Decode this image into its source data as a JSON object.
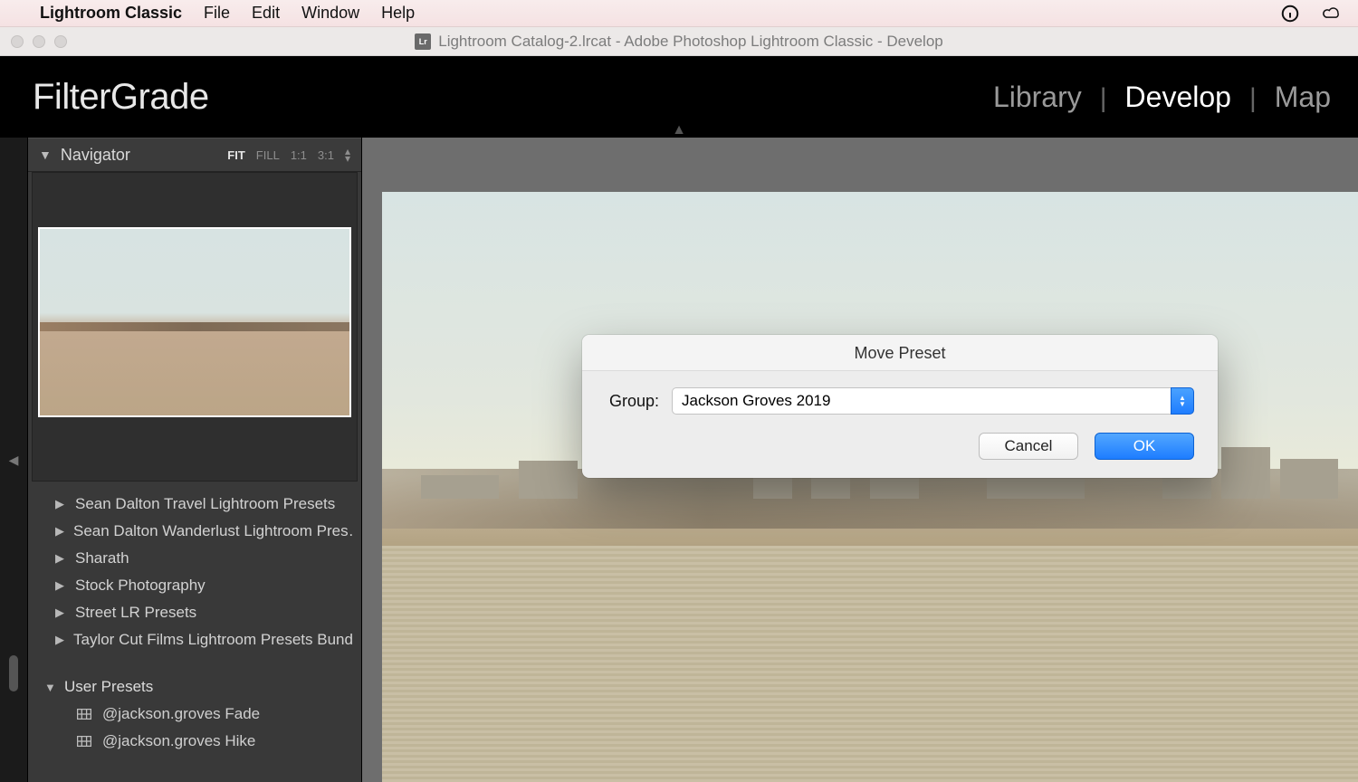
{
  "menubar": {
    "app_name": "Lightroom Classic",
    "items": [
      "File",
      "Edit",
      "Window",
      "Help"
    ]
  },
  "titlebar": {
    "doc_badge": "Lr",
    "title": "Lightroom Catalog-2.lrcat - Adobe Photoshop Lightroom Classic - Develop"
  },
  "brand": "FilterGrade",
  "modules": {
    "library": "Library",
    "develop": "Develop",
    "map": "Map"
  },
  "navigator": {
    "title": "Navigator",
    "zoom": {
      "fit": "FIT",
      "fill": "FILL",
      "one_one": "1:1",
      "ratio": "3:1"
    }
  },
  "preset_groups": [
    "Sean Dalton Travel Lightroom Presets",
    "Sean Dalton Wanderlust Lightroom Pres…",
    "Sharath",
    "Stock Photography",
    "Street LR Presets",
    "Taylor Cut Films Lightroom Presets Bundle"
  ],
  "user_presets": {
    "title": "User Presets",
    "items": [
      "@jackson.groves Fade",
      "@jackson.groves Hike"
    ]
  },
  "dialog": {
    "title": "Move Preset",
    "label": "Group:",
    "value": "Jackson Groves 2019",
    "cancel": "Cancel",
    "ok": "OK"
  }
}
